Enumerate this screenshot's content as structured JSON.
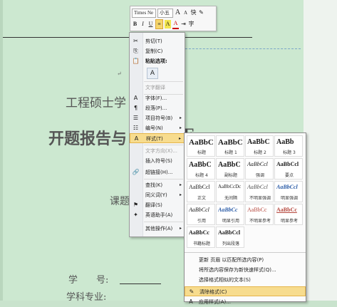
{
  "document": {
    "line1": "工程硕士学",
    "line2a": "开题报告与",
    "line2b": "E",
    "line3": "课题",
    "field1": "学　　号:",
    "field2": "学科专业:",
    "paragraph_mark": "↵"
  },
  "mini_toolbar": {
    "font_name": "Times Ne",
    "font_size": "小五",
    "grow_font": "A",
    "shrink_font": "A",
    "clear": "快",
    "painter": "✎",
    "bold": "B",
    "italic": "I",
    "underline": "U",
    "highlight": "A",
    "font_color": "A",
    "indent": "⇥",
    "phonetic": "字"
  },
  "context_menu": {
    "items": [
      {
        "label": "剪切(T)",
        "icon": "✂",
        "disabled": false
      },
      {
        "label": "复制(C)",
        "icon": "⎘",
        "disabled": false
      },
      {
        "label": "粘贴选项:",
        "icon": "📋",
        "disabled": false
      },
      {
        "label": "文字翻译",
        "icon": "",
        "disabled": true
      },
      {
        "label": "字体(F)...",
        "icon": "A",
        "disabled": false
      },
      {
        "label": "段落(P)...",
        "icon": "¶",
        "disabled": false
      },
      {
        "label": "项目符号(B)",
        "icon": "☰",
        "disabled": false,
        "arrow": "▸"
      },
      {
        "label": "编号(N)",
        "icon": "☷",
        "disabled": false,
        "arrow": "▸"
      },
      {
        "label": "样式(T)",
        "icon": "A",
        "disabled": false,
        "arrow": "▸",
        "hover": true
      },
      {
        "label": "文字方向(X)...",
        "icon": "",
        "disabled": true
      },
      {
        "label": "插入符号(S)",
        "icon": "",
        "disabled": false
      },
      {
        "label": "超链接(H)...",
        "icon": "🔗",
        "disabled": false
      },
      {
        "label": "查找(K)",
        "icon": "",
        "disabled": false,
        "arrow": "▸"
      },
      {
        "label": "同义词(Y)",
        "icon": "",
        "disabled": false,
        "arrow": "▸"
      },
      {
        "label": "翻译(S)",
        "icon": "⚑",
        "disabled": false
      },
      {
        "label": "英语助手(A)",
        "icon": "✦",
        "disabled": false
      },
      {
        "label": "其他操作(A)",
        "icon": "",
        "disabled": false,
        "arrow": "▸"
      }
    ]
  },
  "styles_gallery": {
    "cells": [
      {
        "preview": "AaBbC",
        "name": "标题",
        "selected": false
      },
      {
        "preview": "AaBbC",
        "name": "标题 1",
        "selected": false
      },
      {
        "preview": "AaBbC",
        "name": "标题 2",
        "selected": false
      },
      {
        "preview": "AaBb",
        "name": "标题 3",
        "selected": false
      },
      {
        "preview": "AaBbC",
        "name": "标题 4",
        "selected": false
      },
      {
        "preview": "AaBbC",
        "name": "副标题",
        "selected": false
      },
      {
        "preview": "AaBbCcl",
        "name": "强调",
        "selected": false
      },
      {
        "preview": "AaBbCcl",
        "name": "要点",
        "selected": false
      },
      {
        "preview": "AaBbCcl",
        "name": "正文",
        "selected": false
      },
      {
        "preview": "AaBbCcDc",
        "name": "无间隔",
        "selected": false
      },
      {
        "preview": "AaBbCcl",
        "name": "不明显强调",
        "selected": false
      },
      {
        "preview": "AaBbCcl",
        "name": "明显强调",
        "selected": false
      },
      {
        "preview": "AaBbCcl",
        "name": "引用",
        "selected": false
      },
      {
        "preview": "AaBbCc",
        "name": "明显引用",
        "selected": false
      },
      {
        "preview": "AaBbCc",
        "name": "不明显参考",
        "selected": false
      },
      {
        "preview": "AaBbCc",
        "name": "明显参考",
        "selected": false
      },
      {
        "preview": "AaBbCc",
        "name": "书籍标题",
        "selected": false
      },
      {
        "preview": "AaBbCcl",
        "name": "列出段落",
        "selected": false
      }
    ],
    "actions": [
      {
        "label": "更新 页眉 以匹配所选内容(P)",
        "icon": ""
      },
      {
        "label": "将所选内容保存为新快速样式(Q)...",
        "icon": ""
      },
      {
        "label": "选择格式相似的文本(S)",
        "icon": ""
      },
      {
        "label": "清除格式(C)",
        "icon": "✎",
        "hover": true
      },
      {
        "label": "应用样式(A)...",
        "icon": "A"
      }
    ]
  }
}
